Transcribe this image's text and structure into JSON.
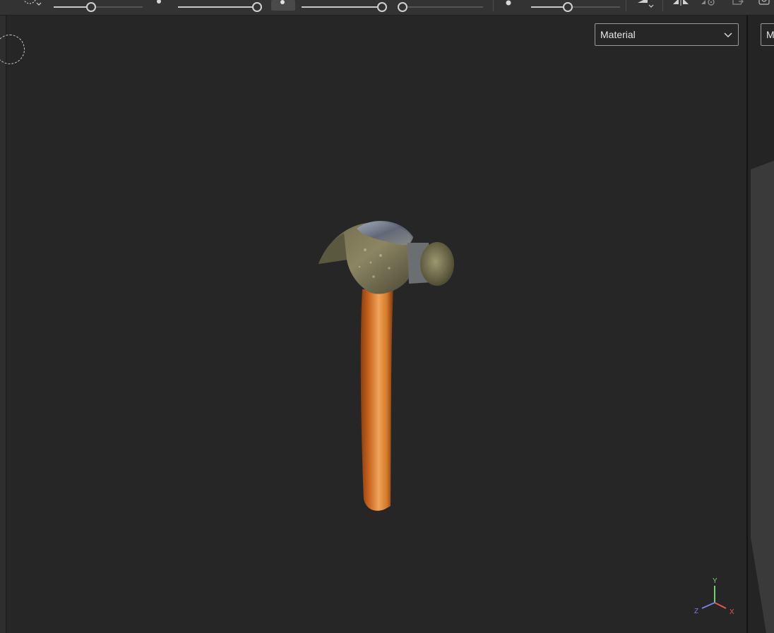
{
  "toolbar": {
    "slider_1": {
      "value": 0.42
    },
    "slider_2": {
      "value": 1.0
    },
    "slider_3": {
      "value": 0.99
    },
    "slider_4": {
      "value": 0.0
    },
    "slider_5": {
      "value": 0.41
    }
  },
  "viewport": {
    "shading_mode": {
      "selected": "Material"
    },
    "right_dropdown": {
      "selected": "M"
    }
  },
  "axis_gizmo": {
    "x_label": "X",
    "y_label": "Y",
    "z_label": "Z"
  },
  "colors": {
    "background": "#262626",
    "toolbar": "#333333",
    "handle_wood": "#d47a2a",
    "axis_x": "#e0584f",
    "axis_y": "#6fd16f",
    "axis_z": "#7a7fe8"
  },
  "icons": [
    "brush-dropdown-icon",
    "dot-icon",
    "brush-mode-icon",
    "symmetry-icon",
    "settings-icon",
    "export-icon",
    "search-icon"
  ]
}
